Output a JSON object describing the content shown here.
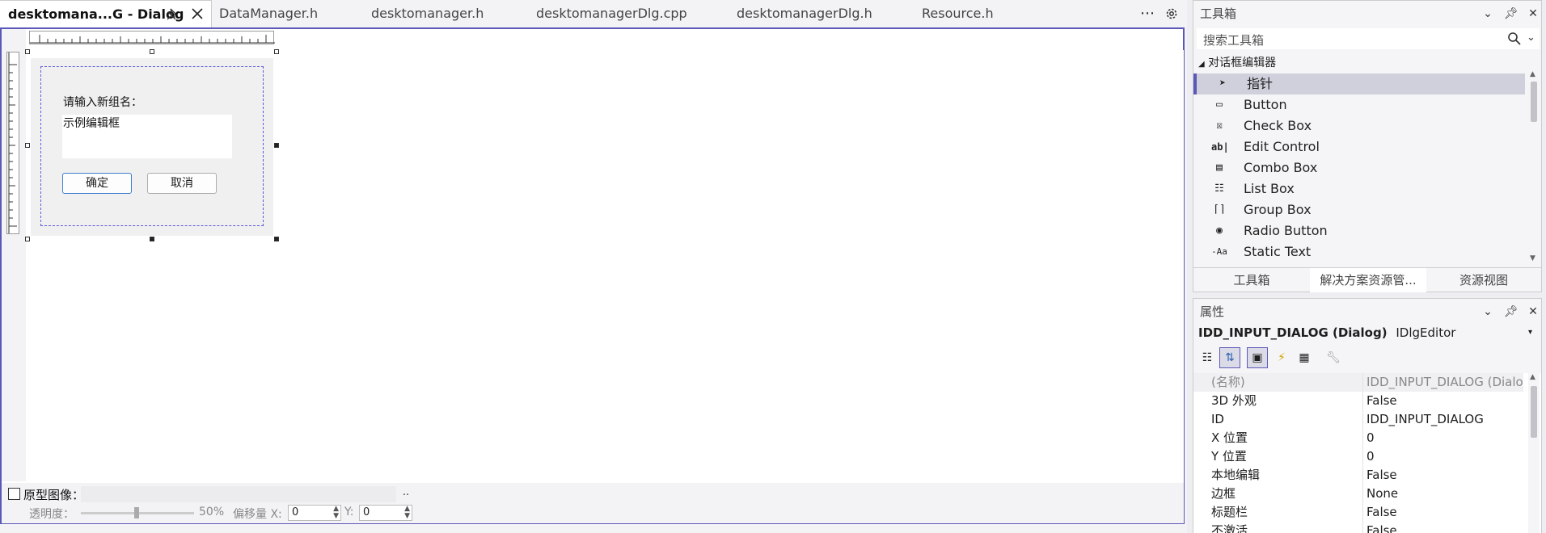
{
  "tabs": [
    {
      "label": "desktomana...G - Dialog",
      "active": true
    },
    {
      "label": "DataManager.h"
    },
    {
      "label": "desktomanager.h"
    },
    {
      "label": "desktomanagerDlg.cpp"
    },
    {
      "label": "desktomanagerDlg.h"
    },
    {
      "label": "Resource.h"
    }
  ],
  "tab_actions": {
    "overflow": "⋯",
    "settings_icon": "gear-icon",
    "pin_icon": "pin-icon",
    "close_icon": "close-icon"
  },
  "dialog": {
    "prompt_label": "请输入新组名：",
    "edit_text": "示例编辑框",
    "ok_label": "确定",
    "cancel_label": "取消"
  },
  "bottom_bar": {
    "prototype_label": "原型图像：",
    "browse_label": "..",
    "opacity_label": "透明度：",
    "opacity_value": "50%",
    "offset_label": "偏移量 X:",
    "x_value": "0",
    "y_label": "Y:",
    "y_value": "0",
    "opacity_level": 0.5
  },
  "toolbox": {
    "title": "工具箱",
    "search_placeholder": "搜索工具箱",
    "group": "对话框编辑器",
    "items": [
      {
        "label": "指针",
        "icon": "pointer-icon",
        "selected": true
      },
      {
        "label": "Button",
        "icon": "button-icon"
      },
      {
        "label": "Check Box",
        "icon": "checkbox-icon"
      },
      {
        "label": "Edit Control",
        "icon": "edit-control-icon"
      },
      {
        "label": "Combo Box",
        "icon": "combobox-icon"
      },
      {
        "label": "List Box",
        "icon": "listbox-icon"
      },
      {
        "label": "Group Box",
        "icon": "groupbox-icon"
      },
      {
        "label": "Radio Button",
        "icon": "radio-icon"
      },
      {
        "label": "Static Text",
        "icon": "static-text-icon"
      }
    ],
    "bottom_tabs": [
      "工具箱",
      "解决方案资源管...",
      "资源视图"
    ]
  },
  "properties": {
    "title": "属性",
    "object_name": "IDD_INPUT_DIALOG (Dialog)",
    "object_type": "IDlgEditor",
    "rows": [
      {
        "key": "(名称)",
        "value": "IDD_INPUT_DIALOG (Dialog"
      },
      {
        "key": "3D 外观",
        "value": "False"
      },
      {
        "key": "ID",
        "value": "IDD_INPUT_DIALOG"
      },
      {
        "key": "X 位置",
        "value": "0"
      },
      {
        "key": "Y 位置",
        "value": "0"
      },
      {
        "key": "本地编辑",
        "value": "False"
      },
      {
        "key": "边框",
        "value": "None"
      },
      {
        "key": "标题栏",
        "value": "False"
      },
      {
        "key": "不激活",
        "value": "False"
      }
    ]
  },
  "colors": {
    "accent": "#5b59b8",
    "selected_row": "#cfd0dc",
    "dialog_bg": "#f0f0f0"
  }
}
